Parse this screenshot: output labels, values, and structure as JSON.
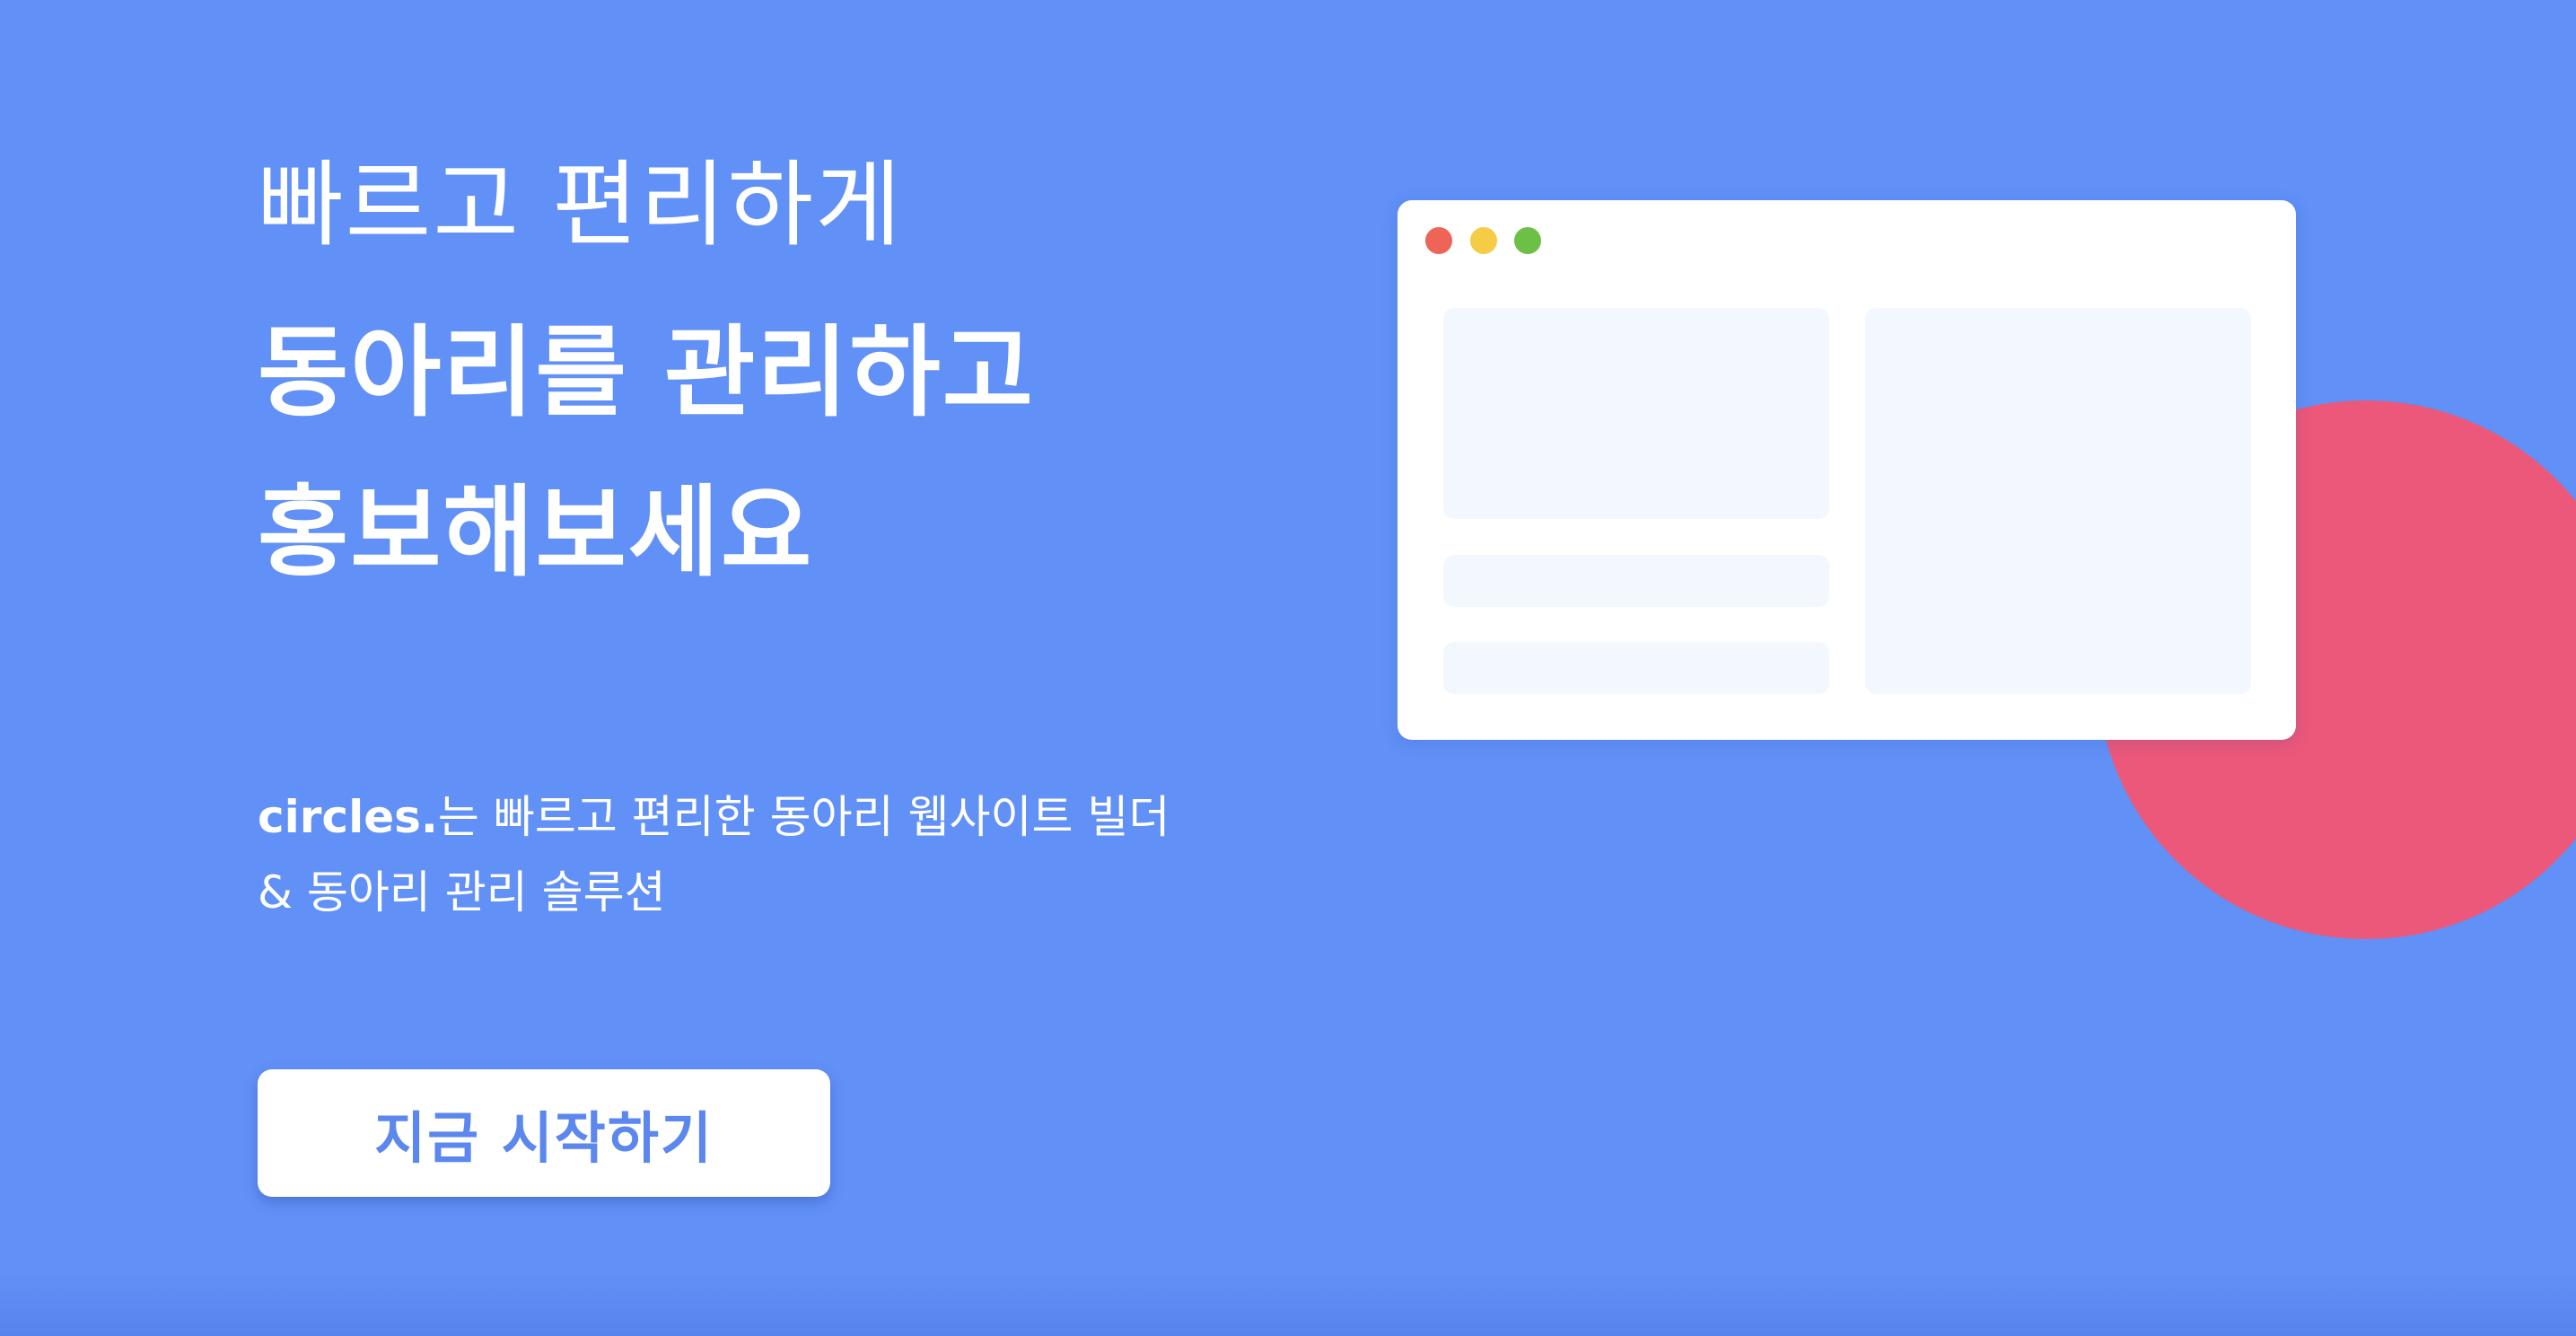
{
  "hero": {
    "headline_line1": "빠르고 편리하게",
    "headline_line2": "동아리를 관리하고",
    "headline_line3": "홍보해보세요",
    "brand": "circles.",
    "description_rest_line1": "는 빠르고 편리한 동아리 웹사이트 빌더",
    "description_line2": "& 동아리 관리 솔루션",
    "cta_label": "지금 시작하기"
  },
  "mockup": {
    "window_dots": [
      {
        "name": "close",
        "color": "#ee6457"
      },
      {
        "name": "minimize",
        "color": "#f6cb45"
      },
      {
        "name": "maximize",
        "color": "#6cc045"
      }
    ]
  },
  "colors": {
    "background": "#6190f6",
    "accent_circle": "#ec587a",
    "button_text": "#5b87ee",
    "placeholder": "#f3f7fe"
  }
}
